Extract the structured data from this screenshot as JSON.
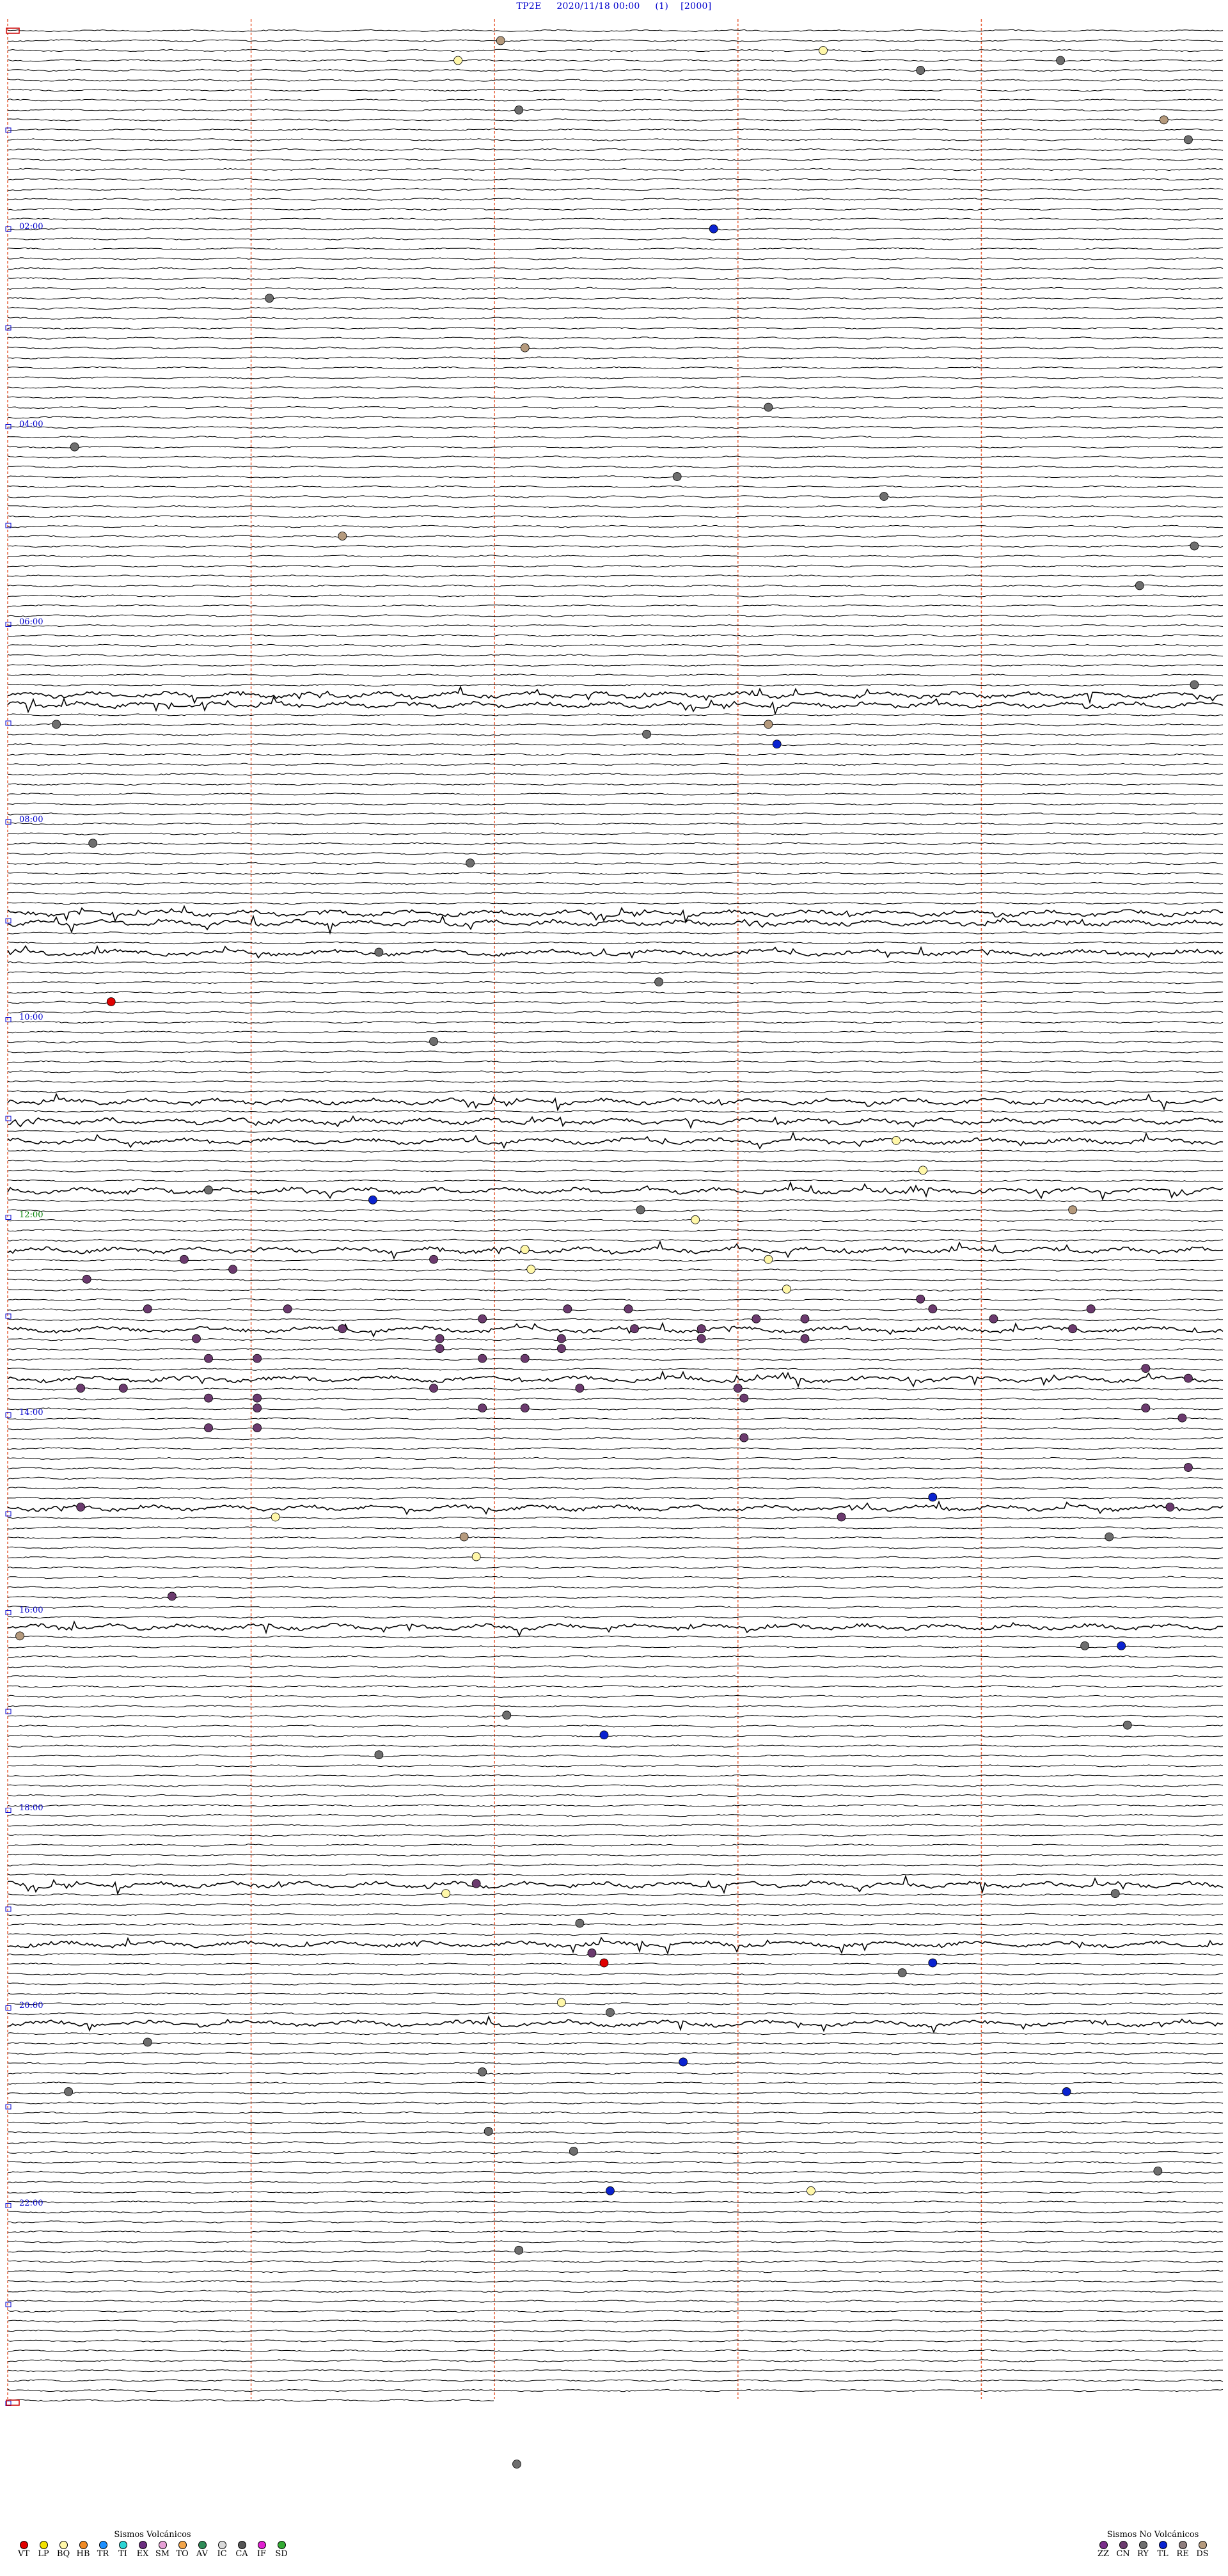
{
  "header": {
    "station": "TP2E",
    "datetime": "2020/11/18 00:00",
    "component": "(1)",
    "scale": "[2000]"
  },
  "chart_data": {
    "type": "scatter",
    "description_kind": "helicorder",
    "rows": 121,
    "minutes_per_row": 12,
    "hour_labels": [
      "02:00",
      "04:00",
      "06:00",
      "08:00",
      "10:00",
      "12:00",
      "14:00",
      "16:00",
      "18:00",
      "20:00",
      "22:00"
    ],
    "hour_label_colors": [
      "#0000cc",
      "#0000cc",
      "#0000cc",
      "#0000cc",
      "#0000cc",
      "#008000",
      "#0000cc",
      "#0000cc",
      "#0000cc",
      "#0000cc",
      "#0000cc"
    ],
    "minute_divisions": [
      0,
      2.4,
      4.8,
      7.2,
      9.6
    ],
    "grid": true,
    "noisy_rows": [
      67,
      68,
      89,
      90,
      93,
      108,
      110,
      112,
      117,
      123,
      131,
      136,
      149,
      161,
      187,
      193,
      201
    ],
    "events": [
      {
        "row": 1,
        "x": 0.405,
        "code": "DS"
      },
      {
        "row": 2,
        "x": 0.67,
        "code": "BQ"
      },
      {
        "row": 3,
        "x": 0.37,
        "code": "BQ"
      },
      {
        "row": 3,
        "x": 0.865,
        "code": "RY"
      },
      {
        "row": 4,
        "x": 0.75,
        "code": "RY"
      },
      {
        "row": 8,
        "x": 0.42,
        "code": "RY"
      },
      {
        "row": 9,
        "x": 0.95,
        "code": "DS"
      },
      {
        "row": 11,
        "x": 0.97,
        "code": "RY"
      },
      {
        "row": 20,
        "x": 0.58,
        "code": "TL"
      },
      {
        "row": 27,
        "x": 0.215,
        "code": "RY"
      },
      {
        "row": 32,
        "x": 0.425,
        "code": "DS"
      },
      {
        "row": 38,
        "x": 0.625,
        "code": "RY"
      },
      {
        "row": 42,
        "x": 0.055,
        "code": "RY"
      },
      {
        "row": 45,
        "x": 0.55,
        "code": "RY"
      },
      {
        "row": 47,
        "x": 0.72,
        "code": "RY"
      },
      {
        "row": 51,
        "x": 0.275,
        "code": "DS"
      },
      {
        "row": 52,
        "x": 0.975,
        "code": "RY"
      },
      {
        "row": 56,
        "x": 0.93,
        "code": "RY"
      },
      {
        "row": 66,
        "x": 0.975,
        "code": "RY"
      },
      {
        "row": 70,
        "x": 0.04,
        "code": "RY"
      },
      {
        "row": 70,
        "x": 0.625,
        "code": "DS"
      },
      {
        "row": 71,
        "x": 0.525,
        "code": "RY"
      },
      {
        "row": 72,
        "x": 0.632,
        "code": "TL"
      },
      {
        "row": 82,
        "x": 0.07,
        "code": "RY"
      },
      {
        "row": 84,
        "x": 0.38,
        "code": "RY"
      },
      {
        "row": 93,
        "x": 0.305,
        "code": "RY"
      },
      {
        "row": 96,
        "x": 0.535,
        "code": "RY"
      },
      {
        "row": 98,
        "x": 0.085,
        "code": "VT"
      },
      {
        "row": 102,
        "x": 0.35,
        "code": "RY"
      },
      {
        "row": 112,
        "x": 0.73,
        "code": "BQ"
      },
      {
        "row": 115,
        "x": 0.752,
        "code": "BQ"
      },
      {
        "row": 117,
        "x": 0.165,
        "code": "RY"
      },
      {
        "row": 118,
        "x": 0.3,
        "code": "TL"
      },
      {
        "row": 119,
        "x": 0.52,
        "code": "RY"
      },
      {
        "row": 119,
        "x": 0.875,
        "code": "DS"
      },
      {
        "row": 120,
        "x": 0.565,
        "code": "BQ"
      },
      {
        "row": 123,
        "x": 0.425,
        "code": "BQ"
      },
      {
        "row": 124,
        "x": 0.145,
        "code": "CN"
      },
      {
        "row": 124,
        "x": 0.35,
        "code": "CN"
      },
      {
        "row": 124,
        "x": 0.625,
        "code": "BQ"
      },
      {
        "row": 125,
        "x": 0.185,
        "code": "CN"
      },
      {
        "row": 125,
        "x": 0.43,
        "code": "BQ"
      },
      {
        "row": 126,
        "x": 0.065,
        "code": "CN"
      },
      {
        "row": 127,
        "x": 0.64,
        "code": "BQ"
      },
      {
        "row": 128,
        "x": 0.75,
        "code": "CN"
      },
      {
        "row": 129,
        "x": 0.115,
        "code": "CN"
      },
      {
        "row": 129,
        "x": 0.23,
        "code": "CN"
      },
      {
        "row": 129,
        "x": 0.46,
        "code": "CN"
      },
      {
        "row": 129,
        "x": 0.51,
        "code": "CN"
      },
      {
        "row": 129,
        "x": 0.76,
        "code": "CN"
      },
      {
        "row": 129,
        "x": 0.89,
        "code": "CN"
      },
      {
        "row": 130,
        "x": 0.39,
        "code": "CN"
      },
      {
        "row": 130,
        "x": 0.615,
        "code": "CN"
      },
      {
        "row": 130,
        "x": 0.655,
        "code": "CN"
      },
      {
        "row": 130,
        "x": 0.81,
        "code": "CN"
      },
      {
        "row": 131,
        "x": 0.275,
        "code": "CN"
      },
      {
        "row": 131,
        "x": 0.515,
        "code": "CN"
      },
      {
        "row": 131,
        "x": 0.57,
        "code": "CN"
      },
      {
        "row": 131,
        "x": 0.875,
        "code": "CN"
      },
      {
        "row": 132,
        "x": 0.155,
        "code": "CN"
      },
      {
        "row": 132,
        "x": 0.355,
        "code": "CN"
      },
      {
        "row": 132,
        "x": 0.455,
        "code": "CN"
      },
      {
        "row": 132,
        "x": 0.57,
        "code": "CN"
      },
      {
        "row": 132,
        "x": 0.655,
        "code": "CN"
      },
      {
        "row": 133,
        "x": 0.355,
        "code": "CN"
      },
      {
        "row": 133,
        "x": 0.455,
        "code": "CN"
      },
      {
        "row": 134,
        "x": 0.165,
        "code": "CN"
      },
      {
        "row": 134,
        "x": 0.205,
        "code": "CN"
      },
      {
        "row": 134,
        "x": 0.39,
        "code": "CN"
      },
      {
        "row": 134,
        "x": 0.425,
        "code": "CN"
      },
      {
        "row": 135,
        "x": 0.935,
        "code": "CN"
      },
      {
        "row": 136,
        "x": 0.97,
        "code": "CN"
      },
      {
        "row": 137,
        "x": 0.06,
        "code": "CN"
      },
      {
        "row": 137,
        "x": 0.095,
        "code": "CN"
      },
      {
        "row": 137,
        "x": 0.35,
        "code": "CN"
      },
      {
        "row": 137,
        "x": 0.47,
        "code": "CN"
      },
      {
        "row": 137,
        "x": 0.6,
        "code": "CN"
      },
      {
        "row": 138,
        "x": 0.165,
        "code": "CN"
      },
      {
        "row": 138,
        "x": 0.205,
        "code": "CN"
      },
      {
        "row": 138,
        "x": 0.605,
        "code": "CN"
      },
      {
        "row": 139,
        "x": 0.205,
        "code": "CN"
      },
      {
        "row": 139,
        "x": 0.39,
        "code": "CN"
      },
      {
        "row": 139,
        "x": 0.425,
        "code": "CN"
      },
      {
        "row": 139,
        "x": 0.935,
        "code": "CN"
      },
      {
        "row": 140,
        "x": 0.965,
        "code": "CN"
      },
      {
        "row": 141,
        "x": 0.165,
        "code": "CN"
      },
      {
        "row": 141,
        "x": 0.205,
        "code": "CN"
      },
      {
        "row": 142,
        "x": 0.605,
        "code": "CN"
      },
      {
        "row": 145,
        "x": 0.97,
        "code": "CN"
      },
      {
        "row": 148,
        "x": 0.76,
        "code": "TL"
      },
      {
        "row": 149,
        "x": 0.06,
        "code": "CN"
      },
      {
        "row": 149,
        "x": 0.955,
        "code": "CN"
      },
      {
        "row": 150,
        "x": 0.22,
        "code": "BQ"
      },
      {
        "row": 150,
        "x": 0.685,
        "code": "CN"
      },
      {
        "row": 152,
        "x": 0.375,
        "code": "DS"
      },
      {
        "row": 152,
        "x": 0.905,
        "code": "RY"
      },
      {
        "row": 154,
        "x": 0.385,
        "code": "BQ"
      },
      {
        "row": 158,
        "x": 0.135,
        "code": "CN"
      },
      {
        "row": 162,
        "x": 0.01,
        "code": "DS"
      },
      {
        "row": 163,
        "x": 0.885,
        "code": "RY"
      },
      {
        "row": 163,
        "x": 0.915,
        "code": "TL"
      },
      {
        "row": 170,
        "x": 0.41,
        "code": "RY"
      },
      {
        "row": 171,
        "x": 0.92,
        "code": "RY"
      },
      {
        "row": 172,
        "x": 0.49,
        "code": "TL"
      },
      {
        "row": 174,
        "x": 0.305,
        "code": "RY"
      },
      {
        "row": 187,
        "x": 0.385,
        "code": "CN"
      },
      {
        "row": 188,
        "x": 0.36,
        "code": "BQ"
      },
      {
        "row": 188,
        "x": 0.91,
        "code": "RY"
      },
      {
        "row": 191,
        "x": 0.47,
        "code": "RY"
      },
      {
        "row": 194,
        "x": 0.48,
        "code": "CN"
      },
      {
        "row": 195,
        "x": 0.49,
        "code": "VT"
      },
      {
        "row": 195,
        "x": 0.76,
        "code": "TL"
      },
      {
        "row": 196,
        "x": 0.735,
        "code": "RY"
      },
      {
        "row": 199,
        "x": 0.455,
        "code": "BQ"
      },
      {
        "row": 200,
        "x": 0.495,
        "code": "RY"
      },
      {
        "row": 203,
        "x": 0.115,
        "code": "RY"
      },
      {
        "row": 205,
        "x": 0.555,
        "code": "TL"
      },
      {
        "row": 206,
        "x": 0.39,
        "code": "RY"
      },
      {
        "row": 208,
        "x": 0.05,
        "code": "RY"
      },
      {
        "row": 208,
        "x": 0.87,
        "code": "TL"
      },
      {
        "row": 212,
        "x": 0.395,
        "code": "RY"
      },
      {
        "row": 214,
        "x": 0.465,
        "code": "RY"
      },
      {
        "row": 216,
        "x": 0.945,
        "code": "RY"
      },
      {
        "row": 218,
        "x": 0.495,
        "code": "TL"
      },
      {
        "row": 218,
        "x": 0.66,
        "code": "BQ"
      },
      {
        "row": 224,
        "x": 0.42,
        "code": "RY"
      }
    ]
  },
  "legend_volcanic": {
    "title": "Sismos Volcánicos",
    "items": [
      {
        "code": "VT",
        "color": "#e00000"
      },
      {
        "code": "LP",
        "color": "#f2e100"
      },
      {
        "code": "BQ",
        "color": "#fff7a8"
      },
      {
        "code": "HB",
        "color": "#f08a24"
      },
      {
        "code": "TR",
        "color": "#1e90ff"
      },
      {
        "code": "TI",
        "color": "#2bd4d4"
      },
      {
        "code": "EX",
        "color": "#6a2c7e"
      },
      {
        "code": "SM",
        "color": "#e6a0d6"
      },
      {
        "code": "TO",
        "color": "#f2a54a"
      },
      {
        "code": "AV",
        "color": "#2e8b57"
      },
      {
        "code": "IC",
        "color": "#d9d9d9"
      },
      {
        "code": "CA",
        "color": "#555555"
      },
      {
        "code": "IF",
        "color": "#e020d0"
      },
      {
        "code": "SD",
        "color": "#33aa33"
      }
    ]
  },
  "legend_nonvolcanic": {
    "title": "Sismos No Volcánicos",
    "items": [
      {
        "code": "ZZ",
        "color": "#7a2d8a"
      },
      {
        "code": "CN",
        "color": "#6b3a6e"
      },
      {
        "code": "RY",
        "color": "#6e6e6e"
      },
      {
        "code": "TL",
        "color": "#0a22d0"
      },
      {
        "code": "RE",
        "color": "#8e7d7d"
      },
      {
        "code": "DS",
        "color": "#b59a7d"
      }
    ]
  },
  "trailing_event_code": "RY"
}
